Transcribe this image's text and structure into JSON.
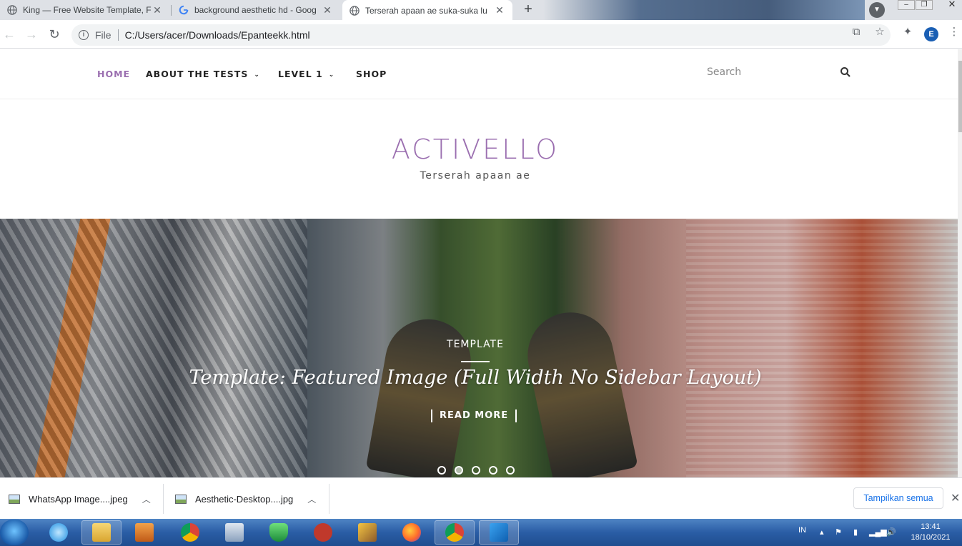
{
  "browser": {
    "tabs": [
      {
        "title": "King — Free Website Template, F",
        "close": "✕"
      },
      {
        "title": "background aesthetic hd - Goog",
        "close": "✕"
      },
      {
        "title": "Terserah apaan ae suka-suka lu",
        "close": "✕"
      }
    ],
    "address": {
      "scheme": "File",
      "url": "C:/Users/acer/Downloads/Epanteekk.html"
    },
    "profile_initial": "E"
  },
  "site": {
    "nav": [
      {
        "label": "HOME",
        "active": true
      },
      {
        "label": "ABOUT THE TESTS",
        "dropdown": true
      },
      {
        "label": "LEVEL 1",
        "dropdown": true
      },
      {
        "label": "SHOP"
      }
    ],
    "search_placeholder": "Search",
    "brand": "ACTIVELLO",
    "tagline": "Terserah apaan ae",
    "hero": {
      "category": "TEMPLATE",
      "title": "Template: Featured Image (Full Width No Sidebar Layout)",
      "cta": "READ MORE",
      "slides": 5,
      "active_slide": 2
    },
    "accent_color": "#9b6fb0"
  },
  "downloads": {
    "items": [
      {
        "name": "WhatsApp Image....jpeg"
      },
      {
        "name": "Aesthetic-Desktop....jpg"
      }
    ],
    "show_all": "Tampilkan semua"
  },
  "taskbar": {
    "language": "IN",
    "time": "13:41",
    "date": "18/10/2021"
  }
}
